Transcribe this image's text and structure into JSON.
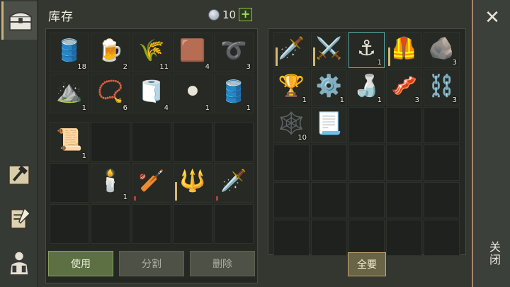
{
  "title": "库存",
  "currency": {
    "icon": "silver-coin-icon",
    "value": "10",
    "add_label": "+"
  },
  "close": {
    "label": "关闭",
    "icon": "close-icon",
    "glyph": "✕"
  },
  "tabs": [
    {
      "name": "tab-chest",
      "icon": "chest-icon"
    },
    {
      "name": "tab-craft",
      "icon": "hammer-map-icon"
    },
    {
      "name": "tab-quest",
      "icon": "scroll-quill-icon"
    },
    {
      "name": "tab-character",
      "icon": "character-backpack-icon"
    }
  ],
  "inventory_top": [
    {
      "icon": "barrel-icon",
      "glyph": "🛢️",
      "count": "18"
    },
    {
      "icon": "mug-icon",
      "glyph": "🍺",
      "count": "2"
    },
    {
      "icon": "fiber-icon",
      "glyph": "🌾",
      "count": "11"
    },
    {
      "icon": "leather-icon",
      "glyph": "🟫",
      "count": "4"
    },
    {
      "icon": "rope-icon",
      "glyph": "➰",
      "count": "3"
    },
    {
      "icon": "powder-pile-icon",
      "glyph": "⛰️",
      "count": "1"
    },
    {
      "icon": "beads-icon",
      "glyph": "📿",
      "count": "6"
    },
    {
      "icon": "cloth-icon",
      "glyph": "🧻",
      "count": "4"
    },
    {
      "icon": "coal-icon",
      "glyph": "⚫",
      "count": "1"
    },
    {
      "icon": "small-barrel-icon",
      "glyph": "🛢️",
      "count": "1"
    }
  ],
  "inventory_bottom": [
    {
      "icon": "scroll-cloth-icon",
      "glyph": "📜",
      "count": "1"
    },
    null,
    null,
    null,
    null,
    null,
    {
      "icon": "candle-icon",
      "glyph": "🕯️",
      "count": "1"
    },
    {
      "icon": "spiked-club-icon",
      "glyph": "🏏",
      "count": "",
      "durability": "red"
    },
    {
      "icon": "mace-icon",
      "glyph": "🔱",
      "count": "",
      "durability": "gold"
    },
    {
      "icon": "sword-icon",
      "glyph": "🗡️",
      "count": "",
      "durability": "red"
    },
    null,
    null,
    null,
    null,
    null
  ],
  "buttons": {
    "use": "使用",
    "split": "分割",
    "delete": "删除",
    "take_all": "全要"
  },
  "storage": [
    {
      "icon": "sword-icon",
      "glyph": "🗡️",
      "count": "",
      "durability": "gold"
    },
    {
      "icon": "scimitar-icon",
      "glyph": "⚔️",
      "count": "",
      "durability": "gold"
    },
    {
      "icon": "wooden-frame-icon",
      "glyph": "⚓",
      "count": "1",
      "selected": true
    },
    {
      "icon": "chainmail-icon",
      "glyph": "🦺",
      "count": "",
      "durability": "gold"
    },
    {
      "icon": "stone-icon",
      "glyph": "🪨",
      "count": "3"
    },
    {
      "icon": "goblet-icon",
      "glyph": "🏆",
      "count": "1"
    },
    {
      "icon": "gears-icon",
      "glyph": "⚙️",
      "count": "1"
    },
    {
      "icon": "flask-icon",
      "glyph": "🍶",
      "count": "1"
    },
    {
      "icon": "leather-strap-icon",
      "glyph": "🥓",
      "count": "3"
    },
    {
      "icon": "chain-icon",
      "glyph": "⛓️",
      "count": "3"
    },
    {
      "icon": "net-icon",
      "glyph": "🕸️",
      "count": "10"
    },
    {
      "icon": "paper-bundle-icon",
      "glyph": "📃",
      "count": ""
    },
    null,
    null,
    null,
    null,
    null,
    null,
    null,
    null,
    null,
    null,
    null,
    null,
    null,
    null,
    null,
    null,
    null,
    null
  ]
}
